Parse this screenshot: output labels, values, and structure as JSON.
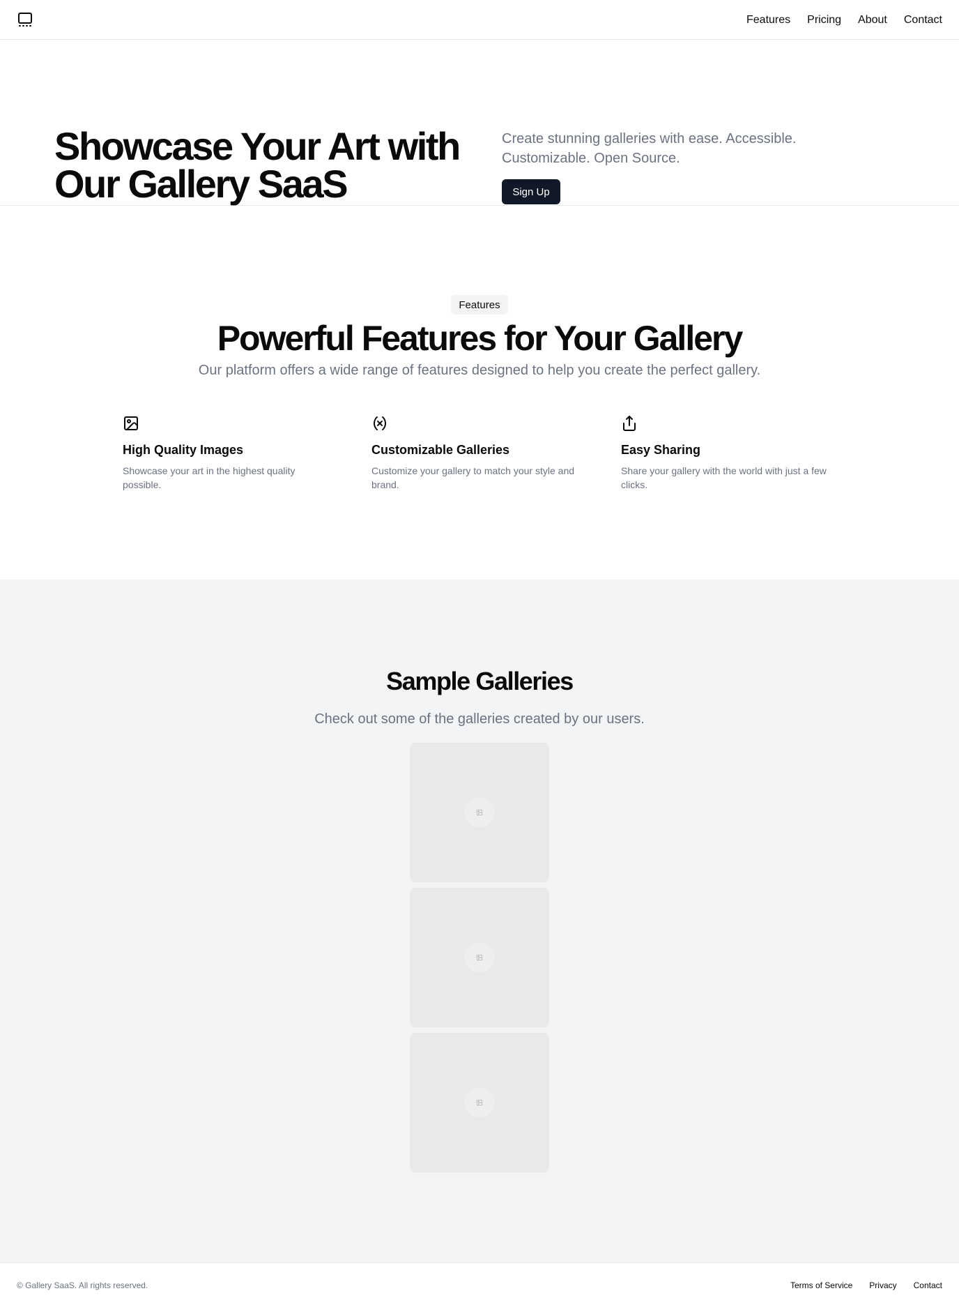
{
  "header": {
    "logo_icon": "gallery-icon",
    "nav": [
      "Features",
      "Pricing",
      "About",
      "Contact"
    ]
  },
  "hero": {
    "title": "Showcase Your Art with Our Gallery SaaS",
    "subtitle": "Create stunning galleries with ease. Accessible. Customizable. Open Source.",
    "cta_label": "Sign Up"
  },
  "features": {
    "badge": "Features",
    "title": "Powerful Features for Your Gallery",
    "subtitle": "Our platform offers a wide range of features designed to help you create the perfect gallery.",
    "items": [
      {
        "icon": "image-icon",
        "title": "High Quality Images",
        "description": "Showcase your art in the highest quality possible."
      },
      {
        "icon": "variable-icon",
        "title": "Customizable Galleries",
        "description": "Customize your gallery to match your style and brand."
      },
      {
        "icon": "share-icon",
        "title": "Easy Sharing",
        "description": "Share your gallery with the world with just a few clicks."
      }
    ]
  },
  "galleries": {
    "title": "Sample Galleries",
    "subtitle": "Check out some of the galleries created by our users.",
    "placeholder_icon": "image-placeholder-icon"
  },
  "footer": {
    "copyright": "© Gallery SaaS. All rights reserved.",
    "links": [
      "Terms of Service",
      "Privacy",
      "Contact"
    ]
  },
  "colors": {
    "primary_button": "#111827",
    "muted_text": "#6b7280",
    "section_bg": "#f3f4f6",
    "border": "#e5e7eb"
  }
}
